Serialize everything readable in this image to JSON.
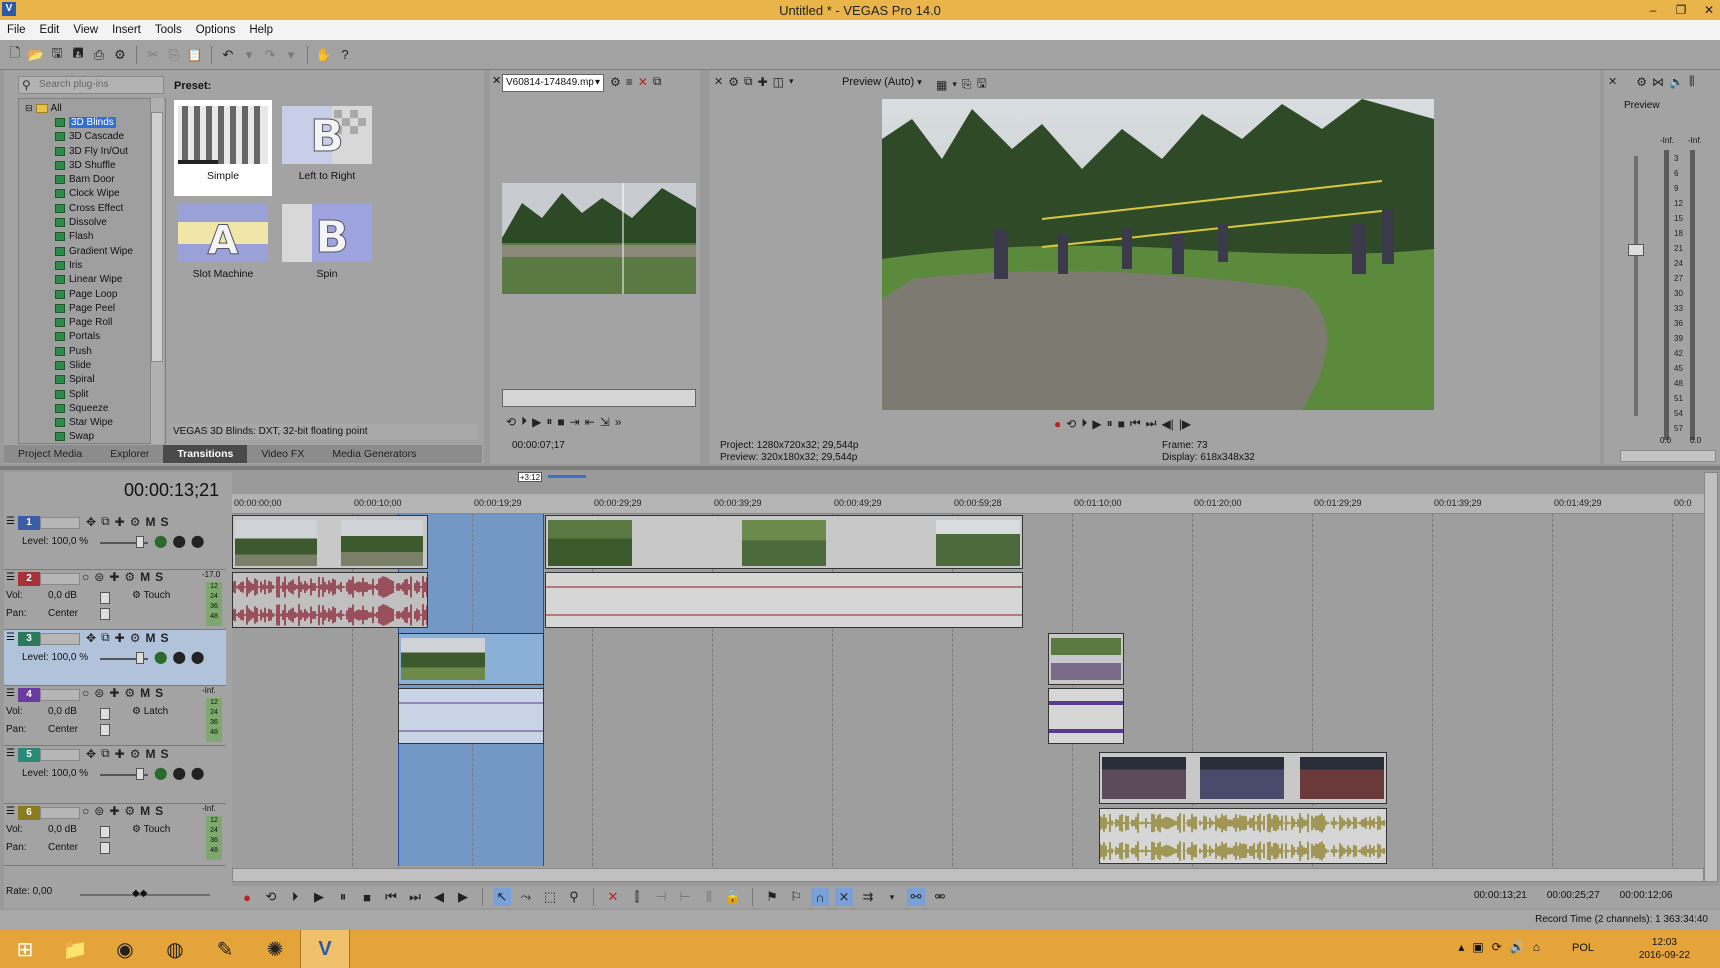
{
  "window": {
    "title": "Untitled * - VEGAS Pro 14.0",
    "logo": "V",
    "minimize": "–",
    "restore": "❐",
    "close": "✕"
  },
  "menu": [
    "File",
    "Edit",
    "View",
    "Insert",
    "Tools",
    "Options",
    "Help"
  ],
  "plugins": {
    "search_placeholder": "Search plug-ins",
    "root": "All",
    "items": [
      "3D Blinds",
      "3D Cascade",
      "3D Fly In/Out",
      "3D Shuffle",
      "Barn Door",
      "Clock Wipe",
      "Cross Effect",
      "Dissolve",
      "Flash",
      "Gradient Wipe",
      "Iris",
      "Linear Wipe",
      "Page Loop",
      "Page Peel",
      "Page Roll",
      "Portals",
      "Push",
      "Slide",
      "Spiral",
      "Split",
      "Squeeze",
      "Star Wipe",
      "Swap"
    ],
    "selected_index": 0
  },
  "presets": {
    "label": "Preset:",
    "items": [
      "Simple",
      "Left to Right",
      "Slot Machine",
      "Spin"
    ],
    "status": "VEGAS 3D Blinds: DXT, 32-bit floating point"
  },
  "tabs": [
    "Project Media",
    "Explorer",
    "Transitions",
    "Video FX",
    "Media Generators"
  ],
  "active_tab": "Transitions",
  "trimmer": {
    "file": "V60814-174849.mp",
    "timecode": "00:00:07;17"
  },
  "preview": {
    "mode": "Preview (Auto)",
    "project_label": "Project:",
    "project_value": "1280x720x32; 29,544p",
    "preview_label": "Preview:",
    "preview_value": "320x180x32; 29,544p",
    "frame_label": "Frame:",
    "frame_value": "73",
    "display_label": "Display:",
    "display_value": "618x348x32"
  },
  "master": {
    "label": "Preview",
    "inf_left": "-Inf.",
    "inf_right": "-Inf.",
    "scale": [
      "3",
      "6",
      "9",
      "12",
      "15",
      "18",
      "21",
      "24",
      "27",
      "30",
      "33",
      "36",
      "39",
      "42",
      "45",
      "48",
      "51",
      "54",
      "57"
    ],
    "value_left": "0.0",
    "value_right": "0.0"
  },
  "timeline": {
    "current_time": "00:00:13;21",
    "loop_badge": "+3:12",
    "ruler": [
      "00:00:00;00",
      "00:00:10;00",
      "00:00:19;29",
      "00:00:29;29",
      "00:00:39;29",
      "00:00:49;29",
      "00:00:59;28",
      "00:01:10;00",
      "00:01:20;00",
      "00:01:29;29",
      "00:01:39;29",
      "00:01:49;29",
      "00:0"
    ],
    "tracks": [
      {
        "num": "1",
        "type": "video",
        "color": "#3b5ca8",
        "level_label": "Level:",
        "level": "100,0 %"
      },
      {
        "num": "2",
        "type": "audio",
        "color": "#a8323a",
        "vol_label": "Vol:",
        "vol": "0,0 dB",
        "pan_label": "Pan:",
        "pan": "Center",
        "mode": "Touch",
        "meter_top": "-17.0"
      },
      {
        "num": "3",
        "type": "video",
        "color": "#2d7a5a",
        "level_label": "Level:",
        "level": "100,0 %"
      },
      {
        "num": "4",
        "type": "audio",
        "color": "#6a3aa0",
        "vol_label": "Vol:",
        "vol": "0,0 dB",
        "pan_label": "Pan:",
        "pan": "Center",
        "mode": "Latch",
        "meter_top": "-Inf."
      },
      {
        "num": "5",
        "type": "video",
        "color": "#2a8a78",
        "level_label": "Level:",
        "level": "100,0 %"
      },
      {
        "num": "6",
        "type": "audio",
        "color": "#8a7a20",
        "vol_label": "Vol:",
        "vol": "0,0 dB",
        "pan_label": "Pan:",
        "pan": "Center",
        "mode": "Touch",
        "meter_top": "-Inf."
      }
    ],
    "meter_scale": [
      "12",
      "24",
      "36",
      "48"
    ],
    "m_label": "M",
    "s_label": "S",
    "rate": "Rate: 0,00"
  },
  "transport_times": {
    "cursor": "00:00:13;21",
    "end": "00:00:25;27",
    "length": "00:00:12;06"
  },
  "status": {
    "record_time": "Record Time (2 channels): 1 363:34:40"
  },
  "taskbar": {
    "lang": "POL",
    "time": "12:03",
    "date": "2016-09-22"
  }
}
